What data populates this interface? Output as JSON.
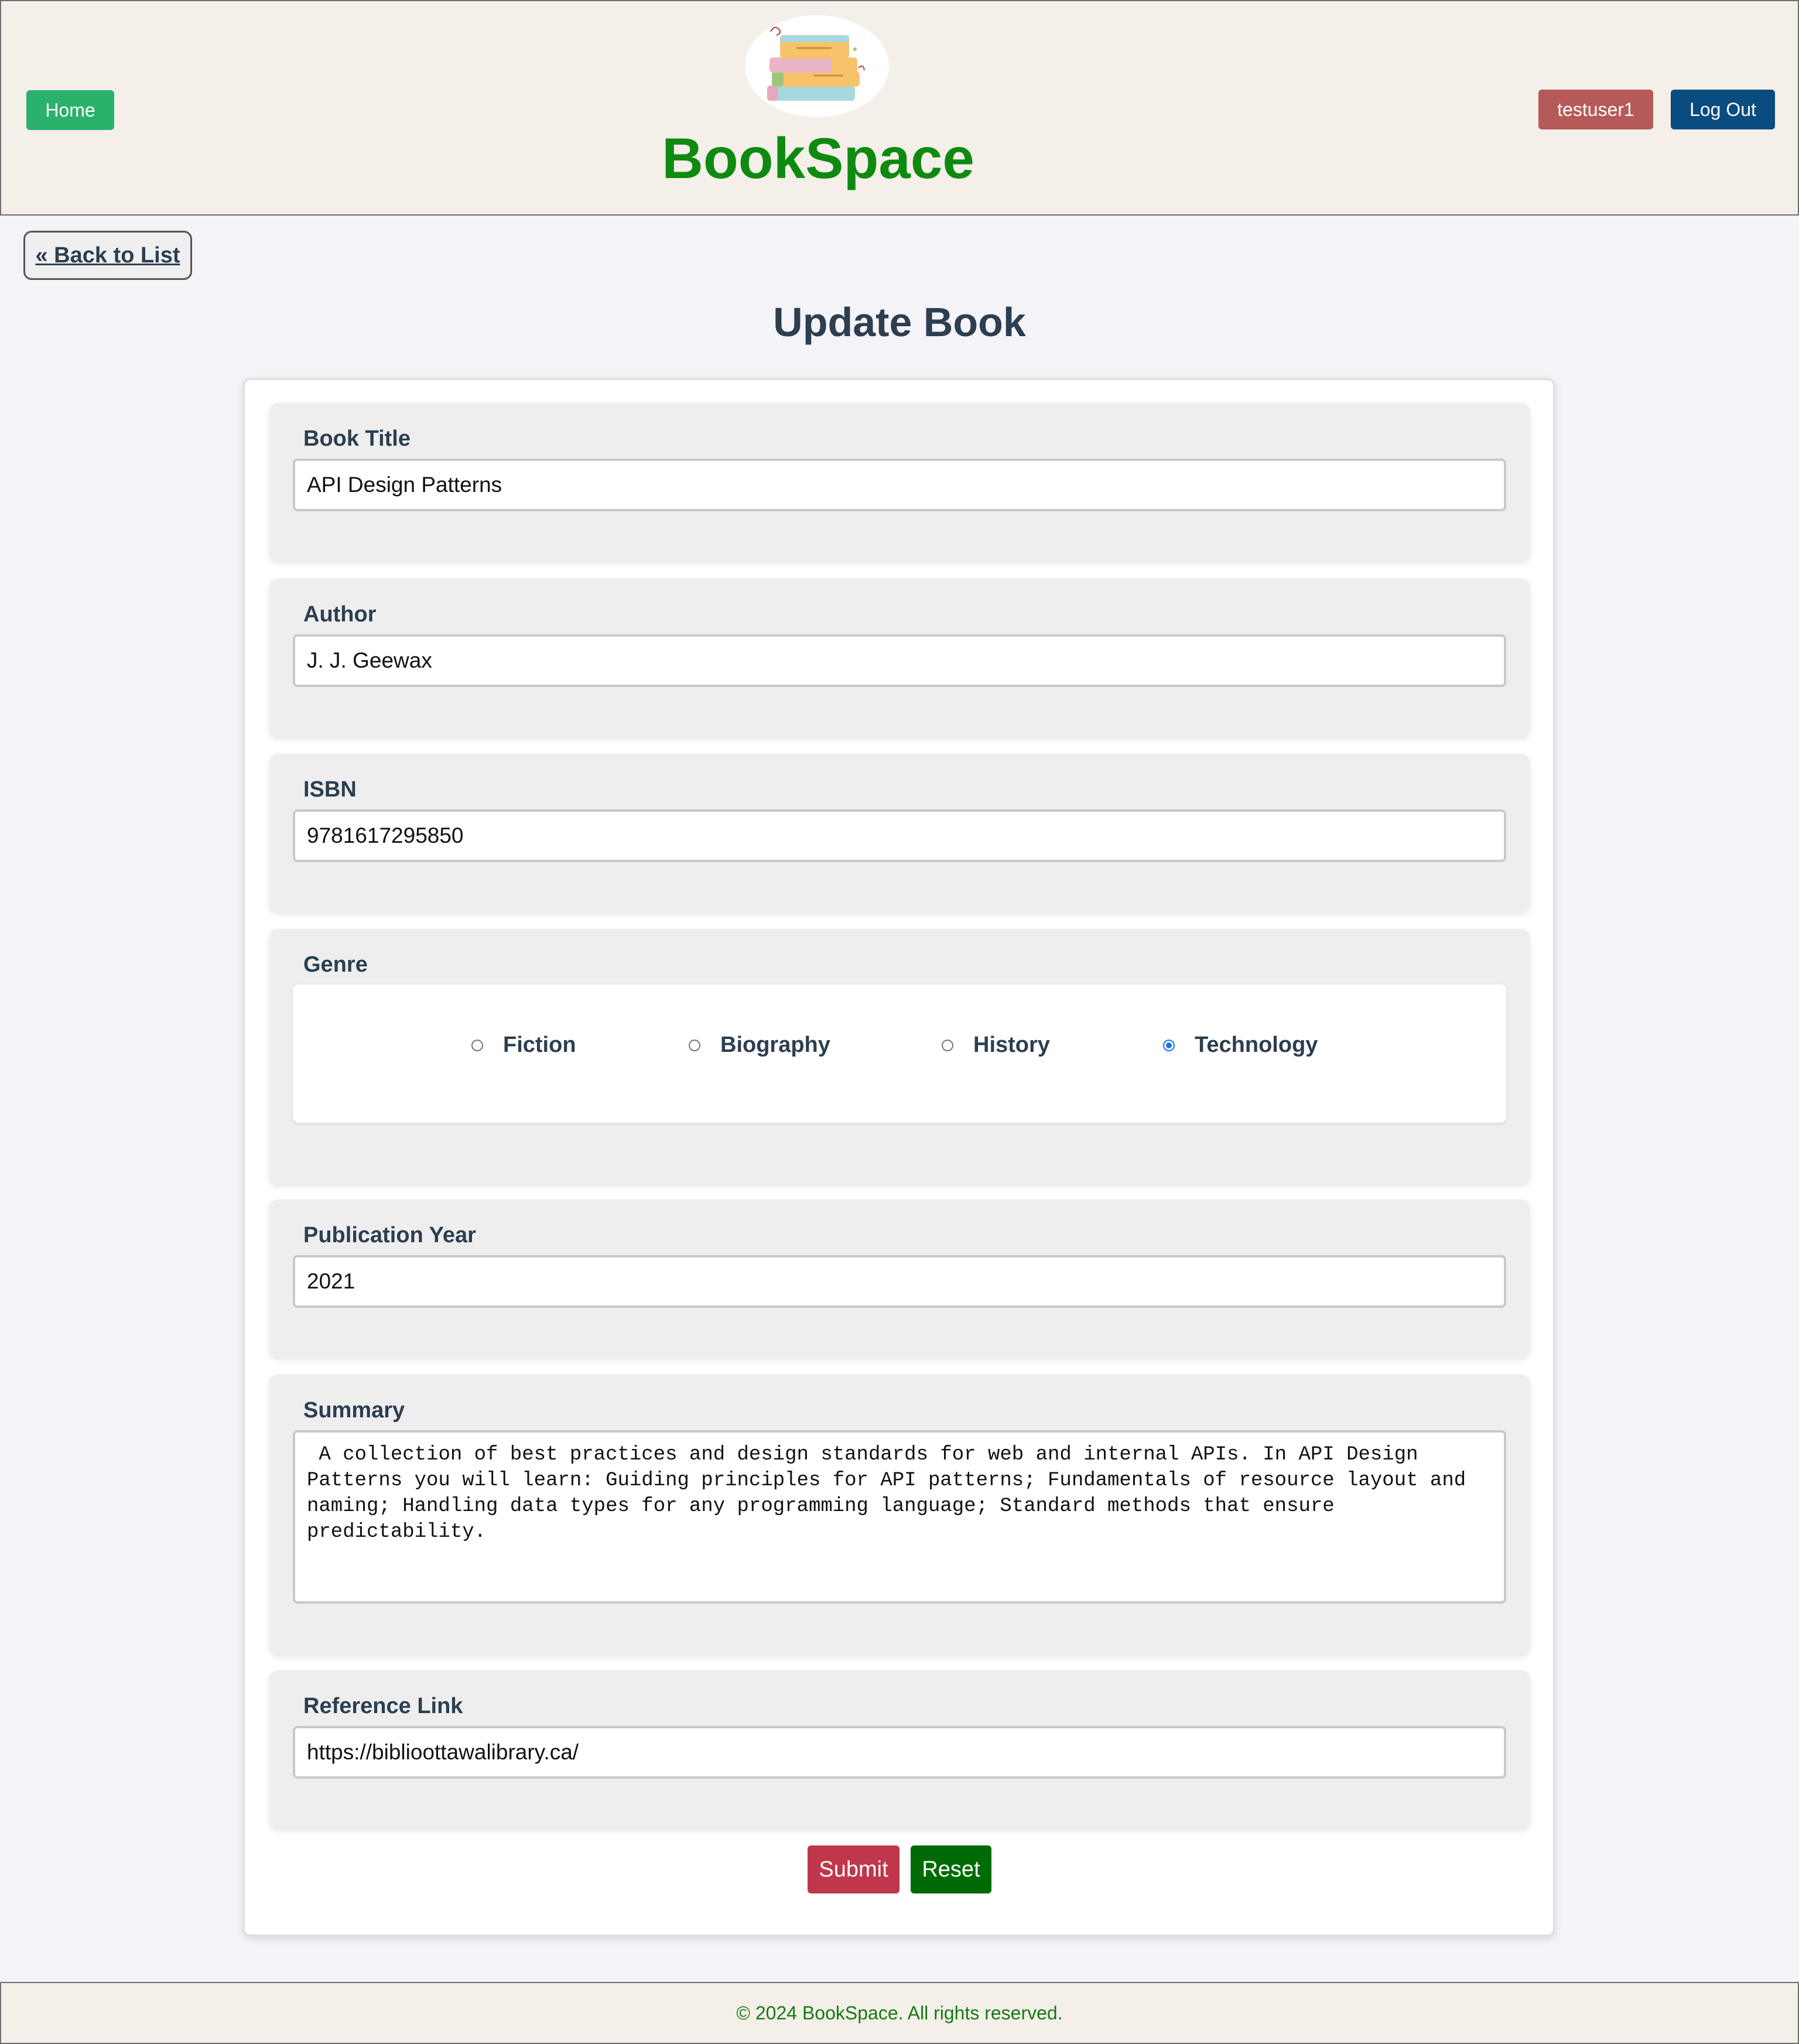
{
  "header": {
    "home_label": "Home",
    "brand": "BookSpace",
    "user_label": "testuser1",
    "logout_label": "Log Out",
    "colors": {
      "home": "#2ab26b",
      "brand": "#0f8a10",
      "user": "#b55a58",
      "logout": "#0a4c7f"
    }
  },
  "back_link": "« Back to List",
  "page_title": "Update Book",
  "form": {
    "title_label": "Book Title",
    "title_value": "API Design Patterns",
    "author_label": "Author",
    "author_value": "J. J. Geewax",
    "isbn_label": "ISBN",
    "isbn_value": "9781617295850",
    "genre_label": "Genre",
    "genres": [
      {
        "label": "Fiction",
        "checked": false
      },
      {
        "label": "Biography",
        "checked": false
      },
      {
        "label": "History",
        "checked": false
      },
      {
        "label": "Technology",
        "checked": true
      }
    ],
    "year_label": "Publication Year",
    "year_value": "2021",
    "summary_label": "Summary",
    "summary_value": " A collection of best practices and design standards for web and internal APIs. In API Design Patterns you will learn: Guiding principles for API patterns; Fundamentals of resource layout and naming; Handling data types for any programming language; Standard methods that ensure predictability.",
    "link_label": "Reference Link",
    "link_value": "https://biblioottawalibrary.ca/",
    "submit_label": "Submit",
    "reset_label": "Reset"
  },
  "footer": {
    "text": "© 2024 BookSpace. All rights reserved."
  },
  "icons": {
    "logo": "stack-of-books-icon"
  }
}
